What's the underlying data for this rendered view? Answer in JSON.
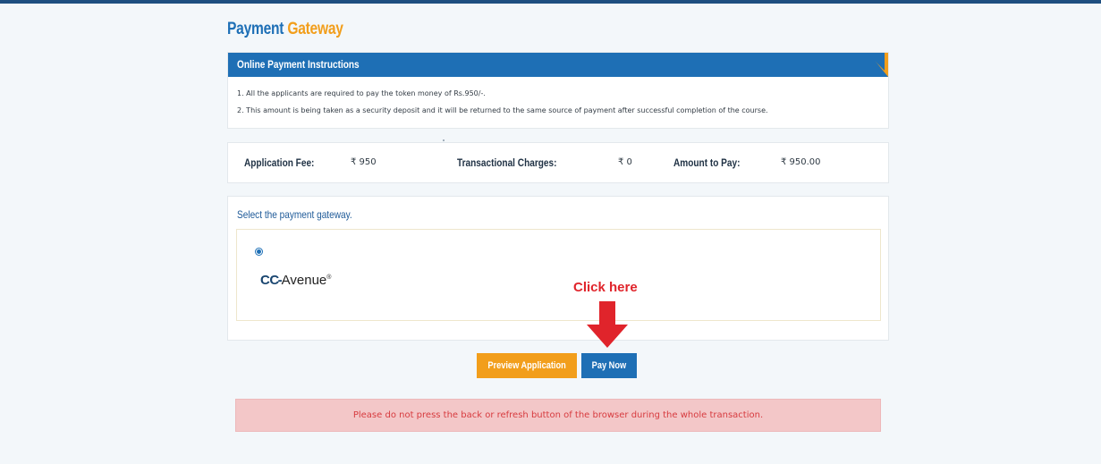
{
  "page_title": {
    "part1": "Payment",
    "part2": "Gateway"
  },
  "instructions": {
    "header": "Online Payment Instructions",
    "lines": [
      "1. All the applicants are required to pay the token money of Rs.950/-.",
      "2. This amount is being taken as a security deposit and it will be returned to the same source of payment after successful completion of the course."
    ]
  },
  "fees": {
    "application_fee_label": "Application Fee:",
    "application_fee_value": "₹ 950",
    "transactional_charges_label": "Transactional Charges:",
    "transactional_charges_value": "₹ 0",
    "amount_to_pay_label": "Amount to Pay:",
    "amount_to_pay_value": "₹ 950.00"
  },
  "gateway": {
    "title": "Select the payment gateway.",
    "options": [
      {
        "name_prefix": "CC",
        "name_suffix": "Avenue",
        "mark": "®",
        "selected": true
      }
    ]
  },
  "annotation": {
    "text": "Click here",
    "color": "#e0242b"
  },
  "buttons": {
    "preview": "Preview Application",
    "pay": "Pay Now"
  },
  "alert": {
    "text": "Please do not press the back or refresh button of the browser during the whole transaction."
  },
  "colors": {
    "primary_blue": "#1e6fb5",
    "accent_orange": "#f29e1b",
    "alert_bg": "#f3c7c8",
    "alert_text": "#d73b3f"
  },
  "icons": {
    "arrow": "arrow-down-icon",
    "radio": "radio-checked-icon"
  }
}
